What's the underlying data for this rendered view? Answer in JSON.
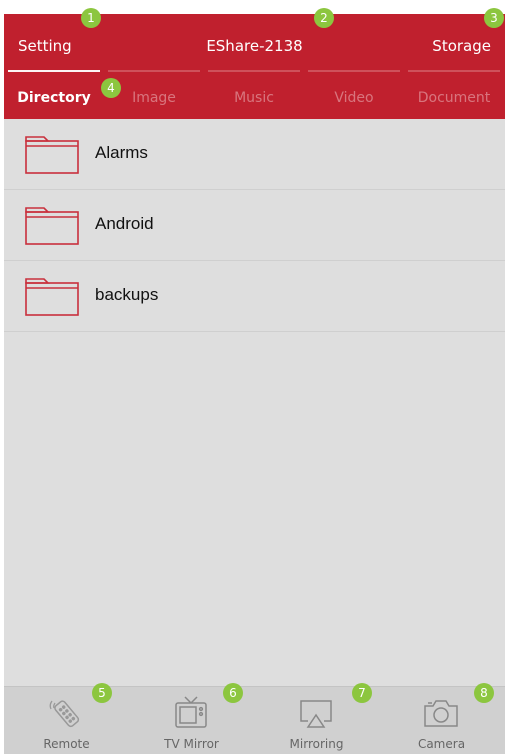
{
  "header": {
    "left_label": "Setting",
    "title": "EShare-2138",
    "right_label": "Storage"
  },
  "tabs": [
    {
      "label": "Directory",
      "active": true
    },
    {
      "label": "Image",
      "active": false
    },
    {
      "label": "Music",
      "active": false
    },
    {
      "label": "Video",
      "active": false
    },
    {
      "label": "Document",
      "active": false
    }
  ],
  "folders": [
    {
      "name": "Alarms",
      "icon": "folder-icon"
    },
    {
      "name": "Android",
      "icon": "folder-icon"
    },
    {
      "name": "backups",
      "icon": "folder-icon"
    }
  ],
  "bottom_nav": [
    {
      "label": "Remote",
      "icon": "remote-icon"
    },
    {
      "label": "TV Mirror",
      "icon": "tv-icon"
    },
    {
      "label": "Mirroring",
      "icon": "airplay-icon"
    },
    {
      "label": "Camera",
      "icon": "camera-icon"
    }
  ],
  "badges": [
    "1",
    "2",
    "3",
    "4",
    "5",
    "6",
    "7",
    "8"
  ],
  "colors": {
    "accent": "#c0202e",
    "background": "#dedede",
    "bottom_bar": "#d0d0d0",
    "badge": "#8cc63f"
  }
}
